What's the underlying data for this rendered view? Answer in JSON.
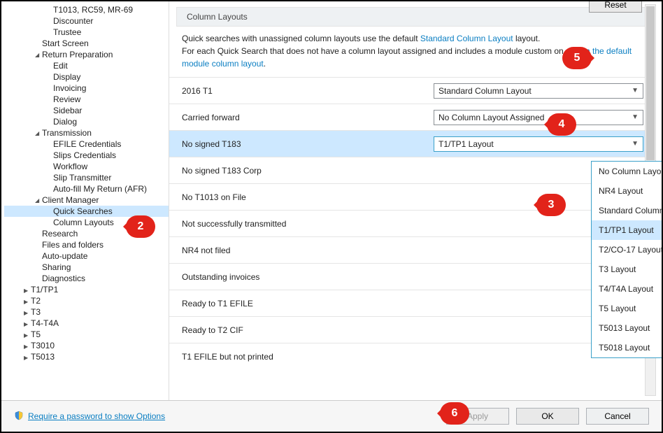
{
  "sidebar": {
    "items": [
      {
        "label": "T1013, RC59, MR-69",
        "cls": "indent3"
      },
      {
        "label": "Discounter",
        "cls": "indent3"
      },
      {
        "label": "Trustee",
        "cls": "indent3"
      },
      {
        "label": "Start Screen",
        "cls": "indent2"
      },
      {
        "label": "Return Preparation",
        "cls": "indent2",
        "caret": "open"
      },
      {
        "label": "Edit",
        "cls": "indent3"
      },
      {
        "label": "Display",
        "cls": "indent3"
      },
      {
        "label": "Invoicing",
        "cls": "indent3"
      },
      {
        "label": "Review",
        "cls": "indent3"
      },
      {
        "label": "Sidebar",
        "cls": "indent3"
      },
      {
        "label": "Dialog",
        "cls": "indent3"
      },
      {
        "label": "Transmission",
        "cls": "indent2",
        "caret": "open"
      },
      {
        "label": "EFILE Credentials",
        "cls": "indent3"
      },
      {
        "label": "Slips Credentials",
        "cls": "indent3"
      },
      {
        "label": "Workflow",
        "cls": "indent3"
      },
      {
        "label": "Slip Transmitter",
        "cls": "indent3"
      },
      {
        "label": "Auto-fill My Return (AFR)",
        "cls": "indent3"
      },
      {
        "label": "Client Manager",
        "cls": "indent2",
        "caret": "open"
      },
      {
        "label": "Quick Searches",
        "cls": "indent3",
        "selected": true
      },
      {
        "label": "Column Layouts",
        "cls": "indent3"
      },
      {
        "label": "Research",
        "cls": "indent2"
      },
      {
        "label": "Files and folders",
        "cls": "indent2"
      },
      {
        "label": "Auto-update",
        "cls": "indent2"
      },
      {
        "label": "Sharing",
        "cls": "indent2"
      },
      {
        "label": "Diagnostics",
        "cls": "indent2"
      },
      {
        "label": "T1/TP1",
        "cls": "indent1",
        "caret": "closed"
      },
      {
        "label": "T2",
        "cls": "indent1",
        "caret": "closed"
      },
      {
        "label": "T3",
        "cls": "indent1",
        "caret": "closed"
      },
      {
        "label": "T4-T4A",
        "cls": "indent1",
        "caret": "closed"
      },
      {
        "label": "T5",
        "cls": "indent1",
        "caret": "closed"
      },
      {
        "label": "T3010",
        "cls": "indent1",
        "caret": "closed"
      },
      {
        "label": "T5013",
        "cls": "indent1",
        "caret": "closed"
      }
    ]
  },
  "content": {
    "reset_button": "Reset",
    "section_title": "Column Layouts",
    "intro_1a": "Quick searches with unassigned column layouts use the default ",
    "intro_1_link": "Standard Column Layout",
    "intro_1b": " layout.",
    "intro_2a": "For each Quick Search that does not have a column layout assigned and includes a module custom ",
    "intro_2_gap": " ",
    "intro_2b": "on ",
    "intro_2_link": "assign the default module column layout",
    "intro_2c": ".",
    "rows": [
      {
        "label": "2016 T1",
        "value": "Standard Column Layout"
      },
      {
        "label": "Carried forward",
        "value": "No Column Layout Assigned"
      },
      {
        "label": "No signed T183",
        "value": "T1/TP1 Layout",
        "open": true,
        "selected": true
      },
      {
        "label": "No signed T183 Corp",
        "value": ""
      },
      {
        "label": "No T1013 on File",
        "value": ""
      },
      {
        "label": "Not successfully transmitted",
        "value": ""
      },
      {
        "label": "NR4 not filed",
        "value": ""
      },
      {
        "label": "Outstanding invoices",
        "value": ""
      },
      {
        "label": "Ready to T1 EFILE",
        "value": ""
      },
      {
        "label": "Ready to T2 CIF",
        "value": ""
      },
      {
        "label": "T1 EFILE but not printed",
        "value": ""
      }
    ],
    "dropdown_options": [
      "No Column Layout Assigned",
      "NR4 Layout",
      "Standard Column Layout",
      "T1/TP1 Layout",
      "T2/CO-17 Layout",
      "T3 Layout",
      "T4/T4A Layout",
      "T5 Layout",
      "T5013 Layout",
      "T5018 Layout"
    ],
    "dropdown_hover_index": 3
  },
  "footer": {
    "require_password": "Require a password to show Options",
    "apply": "Apply",
    "ok": "OK",
    "cancel": "Cancel"
  },
  "callouts": {
    "c2": "2",
    "c3": "3",
    "c4": "4",
    "c5": "5",
    "c6": "6"
  }
}
